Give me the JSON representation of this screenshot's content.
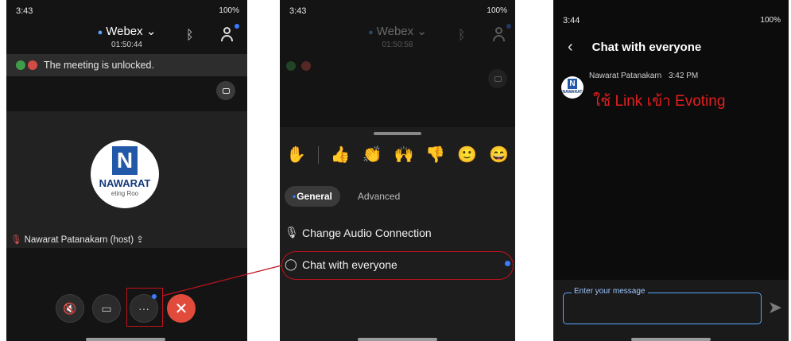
{
  "left_screen": {
    "status_time": "3:43",
    "status_right": "100%",
    "meeting_title": "Webex",
    "timer": "01:50:44",
    "banner_text": "The meeting is unlocked.",
    "logo_text": "NAWARAT",
    "logo_sub": "eting Roo",
    "participant_name": "Nawarat Patanakarn (host)"
  },
  "middle_screen": {
    "status_time": "3:43",
    "status_right": "100%",
    "meeting_title": "Webex",
    "timer": "01:50:58",
    "tabs": [
      "General",
      "Advanced"
    ],
    "menu_items": [
      "Change Audio Connection",
      "Chat with everyone"
    ]
  },
  "right_screen": {
    "status_time": "3:44",
    "status_right": "100%",
    "chat_title": "Chat with everyone",
    "sender": "Nawarat Patanakarn",
    "sent_time": "3:42 PM",
    "message": "ใช้ Link เข้า Evoting",
    "input_placeholder": "Enter your message",
    "avatar_text": "NAWARAT"
  },
  "colors": {
    "accent": "#3b7bff",
    "end_call": "#e04b3c",
    "highlight": "#c0121d",
    "message_text": "#e21f1f"
  }
}
